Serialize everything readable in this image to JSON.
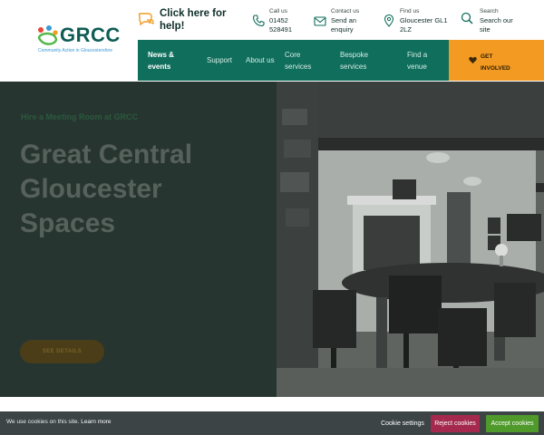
{
  "brand": {
    "name": "GRCC",
    "tagline": "Community Action in Gloucestershire"
  },
  "header": {
    "help": "Click here for help!",
    "contacts": [
      {
        "label": "Call us",
        "value": "01452 528491",
        "icon": "phone-icon"
      },
      {
        "label": "Contact us",
        "value": "Send an enquiry",
        "icon": "envelope-icon"
      },
      {
        "label": "Find us",
        "value": "Gloucester GL1 2LZ",
        "icon": "map-pin-icon"
      },
      {
        "label": "Search",
        "value": "Search our site",
        "icon": "search-icon"
      }
    ]
  },
  "nav": {
    "items": [
      {
        "label": "News & events",
        "active": true
      },
      {
        "label": "Support"
      },
      {
        "label": "About us"
      },
      {
        "label": "Core services"
      },
      {
        "label": "Bespoke services"
      },
      {
        "label": "Find a venue"
      }
    ],
    "cta": "GET INVOLVED"
  },
  "hero": {
    "eyebrow": "Hire a Meeting Room at GRCC",
    "title": "Great Central Gloucester Spaces",
    "button": "SEE DETAILS",
    "image": "meeting-room-photo"
  },
  "cookie": {
    "message": "We use cookies on this site.",
    "learn_more": "Learn more",
    "settings": "Cookie settings",
    "reject": "Reject cookies",
    "accept": "Accept cookies"
  },
  "colors": {
    "brand_teal": "#0f6e5c",
    "accent_orange": "#f29a22",
    "hero_overlay": "#273531",
    "reject_red": "#a5294f",
    "accept_green": "#4f9a2a",
    "cookie_bar": "#3c4446"
  }
}
